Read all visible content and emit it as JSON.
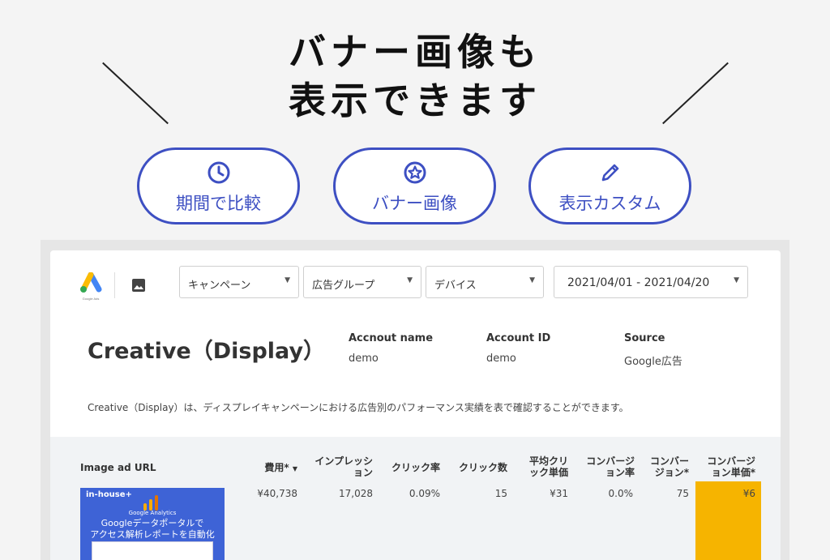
{
  "headline": {
    "line1": "バナー画像も",
    "line2": "表示できます"
  },
  "features": [
    {
      "label": "期間で比較",
      "icon": "clock-icon"
    },
    {
      "label": "バナー画像",
      "icon": "star-circle-icon"
    },
    {
      "label": "表示カスタム",
      "icon": "pencil-icon"
    }
  ],
  "toolbar": {
    "logo_caption": "Google Ads",
    "filters": [
      "キャンペーン",
      "広告グループ",
      "デバイス"
    ],
    "date_range": "2021/04/01 - 2021/04/20"
  },
  "report": {
    "title": "Creative（Display）",
    "meta": [
      {
        "label": "Accnout name",
        "value": "demo"
      },
      {
        "label": "Account ID",
        "value": "demo"
      },
      {
        "label": "Source",
        "value": "Google広告"
      }
    ],
    "description": "Creative（Display）は、ディスプレイキャンペーンにおける広告別のパフォーマンス実績を表で確認することができます。"
  },
  "table": {
    "headers": [
      "Image ad URL",
      "費用*",
      "インプレッション",
      "クリック率",
      "クリック数",
      "平均クリック単価",
      "コンバージョン率",
      "コンバージョン*",
      "コンバージョン単価*"
    ],
    "sort_icon": "sort-down-icon",
    "rows": [
      {
        "banner": {
          "brand": "in-house+",
          "sub": "Google Analytics",
          "headline1": "Googleデータポータルで",
          "headline2": "アクセス解析レポートを自動化"
        },
        "cost": "¥40,738",
        "impressions": "17,028",
        "ctr": "0.09%",
        "clicks": "15",
        "cpc": "¥31",
        "cvr": "0.0%",
        "conversions": "75",
        "cpa": "¥6"
      }
    ]
  },
  "colors": {
    "accent": "#3d4fc2",
    "highlight": "#f6b400",
    "banner": "#3e63d6"
  }
}
